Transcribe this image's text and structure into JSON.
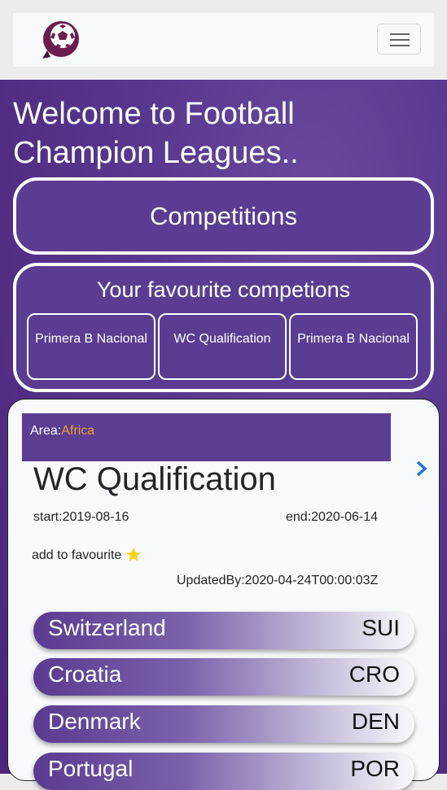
{
  "header": {
    "logo_icon": "football-logo-icon",
    "menu_icon": "hamburger-menu-icon"
  },
  "hero": {
    "welcome": "Welcome to Football Champion Leagues.."
  },
  "competitions_button": "Competitions",
  "favourites": {
    "title": "Your favourite competions",
    "items": [
      {
        "label": "Primera B Nacional"
      },
      {
        "label": "WC Qualification"
      },
      {
        "label": "Primera B Nacional"
      }
    ]
  },
  "competition": {
    "area_label": "Area:",
    "area_value": "Africa",
    "title": "WC Qualification",
    "start": "start:2019-08-16",
    "end": "end:2020-06-14",
    "add_favourite": "add to favourite",
    "star_icon": "star-icon",
    "updated": "UpdatedBy:2020-04-24T00:00:03Z",
    "next_icon": "chevron-right-icon"
  },
  "teams": [
    {
      "name": "Switzerland",
      "code": "SUI"
    },
    {
      "name": "Croatia",
      "code": "CRO"
    },
    {
      "name": "Denmark",
      "code": "DEN"
    },
    {
      "name": "Portugal",
      "code": "POR"
    }
  ],
  "colors": {
    "primary": "#5a3d92",
    "accent": "#f0a030",
    "link": "#1a73e8"
  }
}
